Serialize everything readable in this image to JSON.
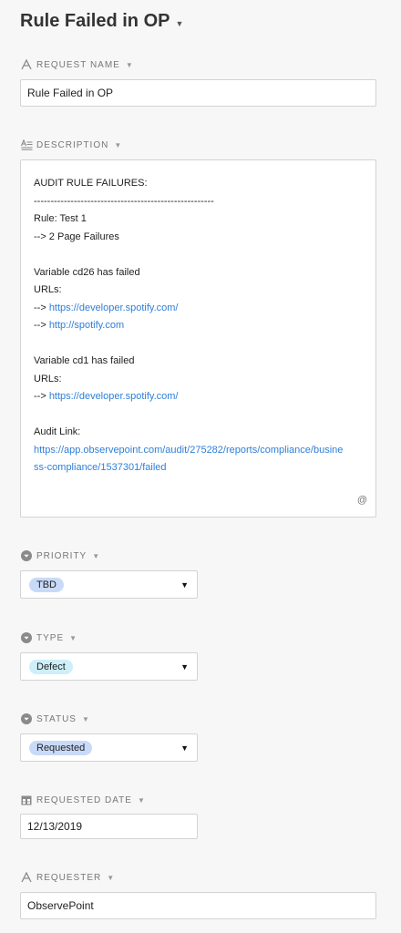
{
  "header": {
    "title": "Rule Failed in OP"
  },
  "request_name": {
    "label": "REQUEST NAME",
    "value": "Rule Failed in OP",
    "icon": "text-a-icon"
  },
  "description": {
    "label": "DESCRIPTION",
    "icon": "text-lines-icon",
    "lines": [
      {
        "text": "AUDIT RULE FAILURES:"
      },
      {
        "text": "------------------------------------------------------"
      },
      {
        "text": "Rule: Test 1"
      },
      {
        "text": "--> 2 Page Failures"
      },
      {
        "text": ""
      },
      {
        "text": "Variable cd26 has failed"
      },
      {
        "text": "URLs:"
      },
      {
        "text": "--> ",
        "link": "https://developer.spotify.com/"
      },
      {
        "text": "--> ",
        "link": "http://spotify.com"
      },
      {
        "text": ""
      },
      {
        "text": "Variable cd1 has failed"
      },
      {
        "text": "URLs:"
      },
      {
        "text": "--> ",
        "link": "https://developer.spotify.com/"
      },
      {
        "text": ""
      },
      {
        "text": "Audit Link:"
      },
      {
        "text": "",
        "link": "https://app.observepoint.com/audit/275282/reports/compliance/busine"
      },
      {
        "text": "",
        "link": "ss-compliance/1537301/failed"
      }
    ],
    "mention_symbol": "@"
  },
  "priority": {
    "label": "PRIORITY",
    "value": "TBD",
    "badge_color": "#c9daf8",
    "icon": "chevron-circle-icon"
  },
  "type": {
    "label": "TYPE",
    "value": "Defect",
    "badge_color": "#cdeff8",
    "icon": "chevron-circle-icon"
  },
  "status": {
    "label": "STATUS",
    "value": "Requested",
    "badge_color": "#c9daf8",
    "icon": "chevron-circle-icon"
  },
  "requested_date": {
    "label": "REQUESTED DATE",
    "value": "12/13/2019",
    "icon": "calendar-icon"
  },
  "requester": {
    "label": "REQUESTER",
    "value": "ObservePoint",
    "icon": "text-a-icon"
  },
  "colors": {
    "link": "#2f7fd8",
    "background": "#f7f7f7"
  }
}
